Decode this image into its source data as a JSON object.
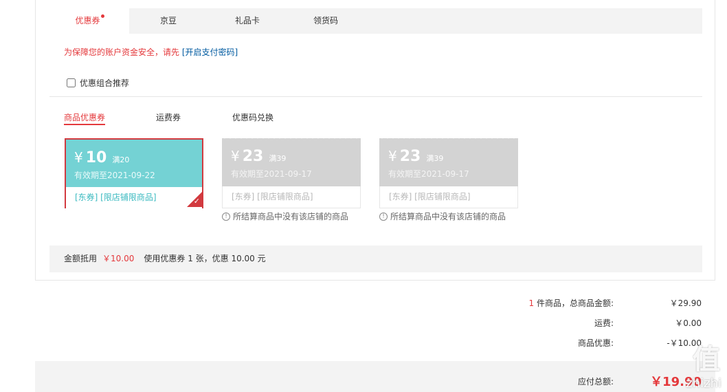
{
  "tabs": [
    {
      "label": "优惠券",
      "active": true
    },
    {
      "label": "京豆",
      "active": false
    },
    {
      "label": "礼品卡",
      "active": false
    },
    {
      "label": "领货码",
      "active": false
    }
  ],
  "warning": {
    "text": "为保障您的账户资金安全，请先",
    "link": "[开启支付密码]"
  },
  "combo_label": "优惠组合推荐",
  "subtabs": [
    {
      "label": "商品优惠券",
      "active": true
    },
    {
      "label": "运费券",
      "active": false
    },
    {
      "label": "优惠码兑换",
      "active": false
    }
  ],
  "coupons": [
    {
      "yen": "¥",
      "amount": "10",
      "condition": "满20",
      "expiry": "有效期至2021-09-22",
      "tags": "[东券]  [限店铺限商品]",
      "selected": true,
      "reason": ""
    },
    {
      "yen": "¥",
      "amount": "23",
      "condition": "满39",
      "expiry": "有效期至2021-09-17",
      "tags": "[东券]  [限店铺限商品]",
      "selected": false,
      "reason": "所结算商品中没有该店铺的商品"
    },
    {
      "yen": "¥",
      "amount": "23",
      "condition": "满39",
      "expiry": "有效期至2021-09-17",
      "tags": "[东券]  [限店铺限商品]",
      "selected": false,
      "reason": "所结算商品中没有该店铺的商品"
    }
  ],
  "summary": {
    "label": "金额抵用",
    "amount": "￥10.00",
    "detail": "使用优惠券 1 张，优惠 10.00 元"
  },
  "totals": {
    "count": "1",
    "goods_label": " 件商品，总商品金额:",
    "goods_value": "￥29.90",
    "freight_label": "运费:",
    "freight_value": "￥0.00",
    "discount_label": "商品优惠:",
    "discount_value": "-￥10.00",
    "payable_label": "应付总额:",
    "payable_value": "￥19.90"
  },
  "watermark": {
    "big": "值",
    "small": "zhizhi"
  },
  "colors": {
    "accent": "#e4393c",
    "coupon_active": "#74d2d4",
    "coupon_disabled": "#d3d3d3",
    "link": "#005aa0"
  },
  "icons": {
    "selected_check": "check-icon",
    "reason_info": "info-circle-icon"
  }
}
